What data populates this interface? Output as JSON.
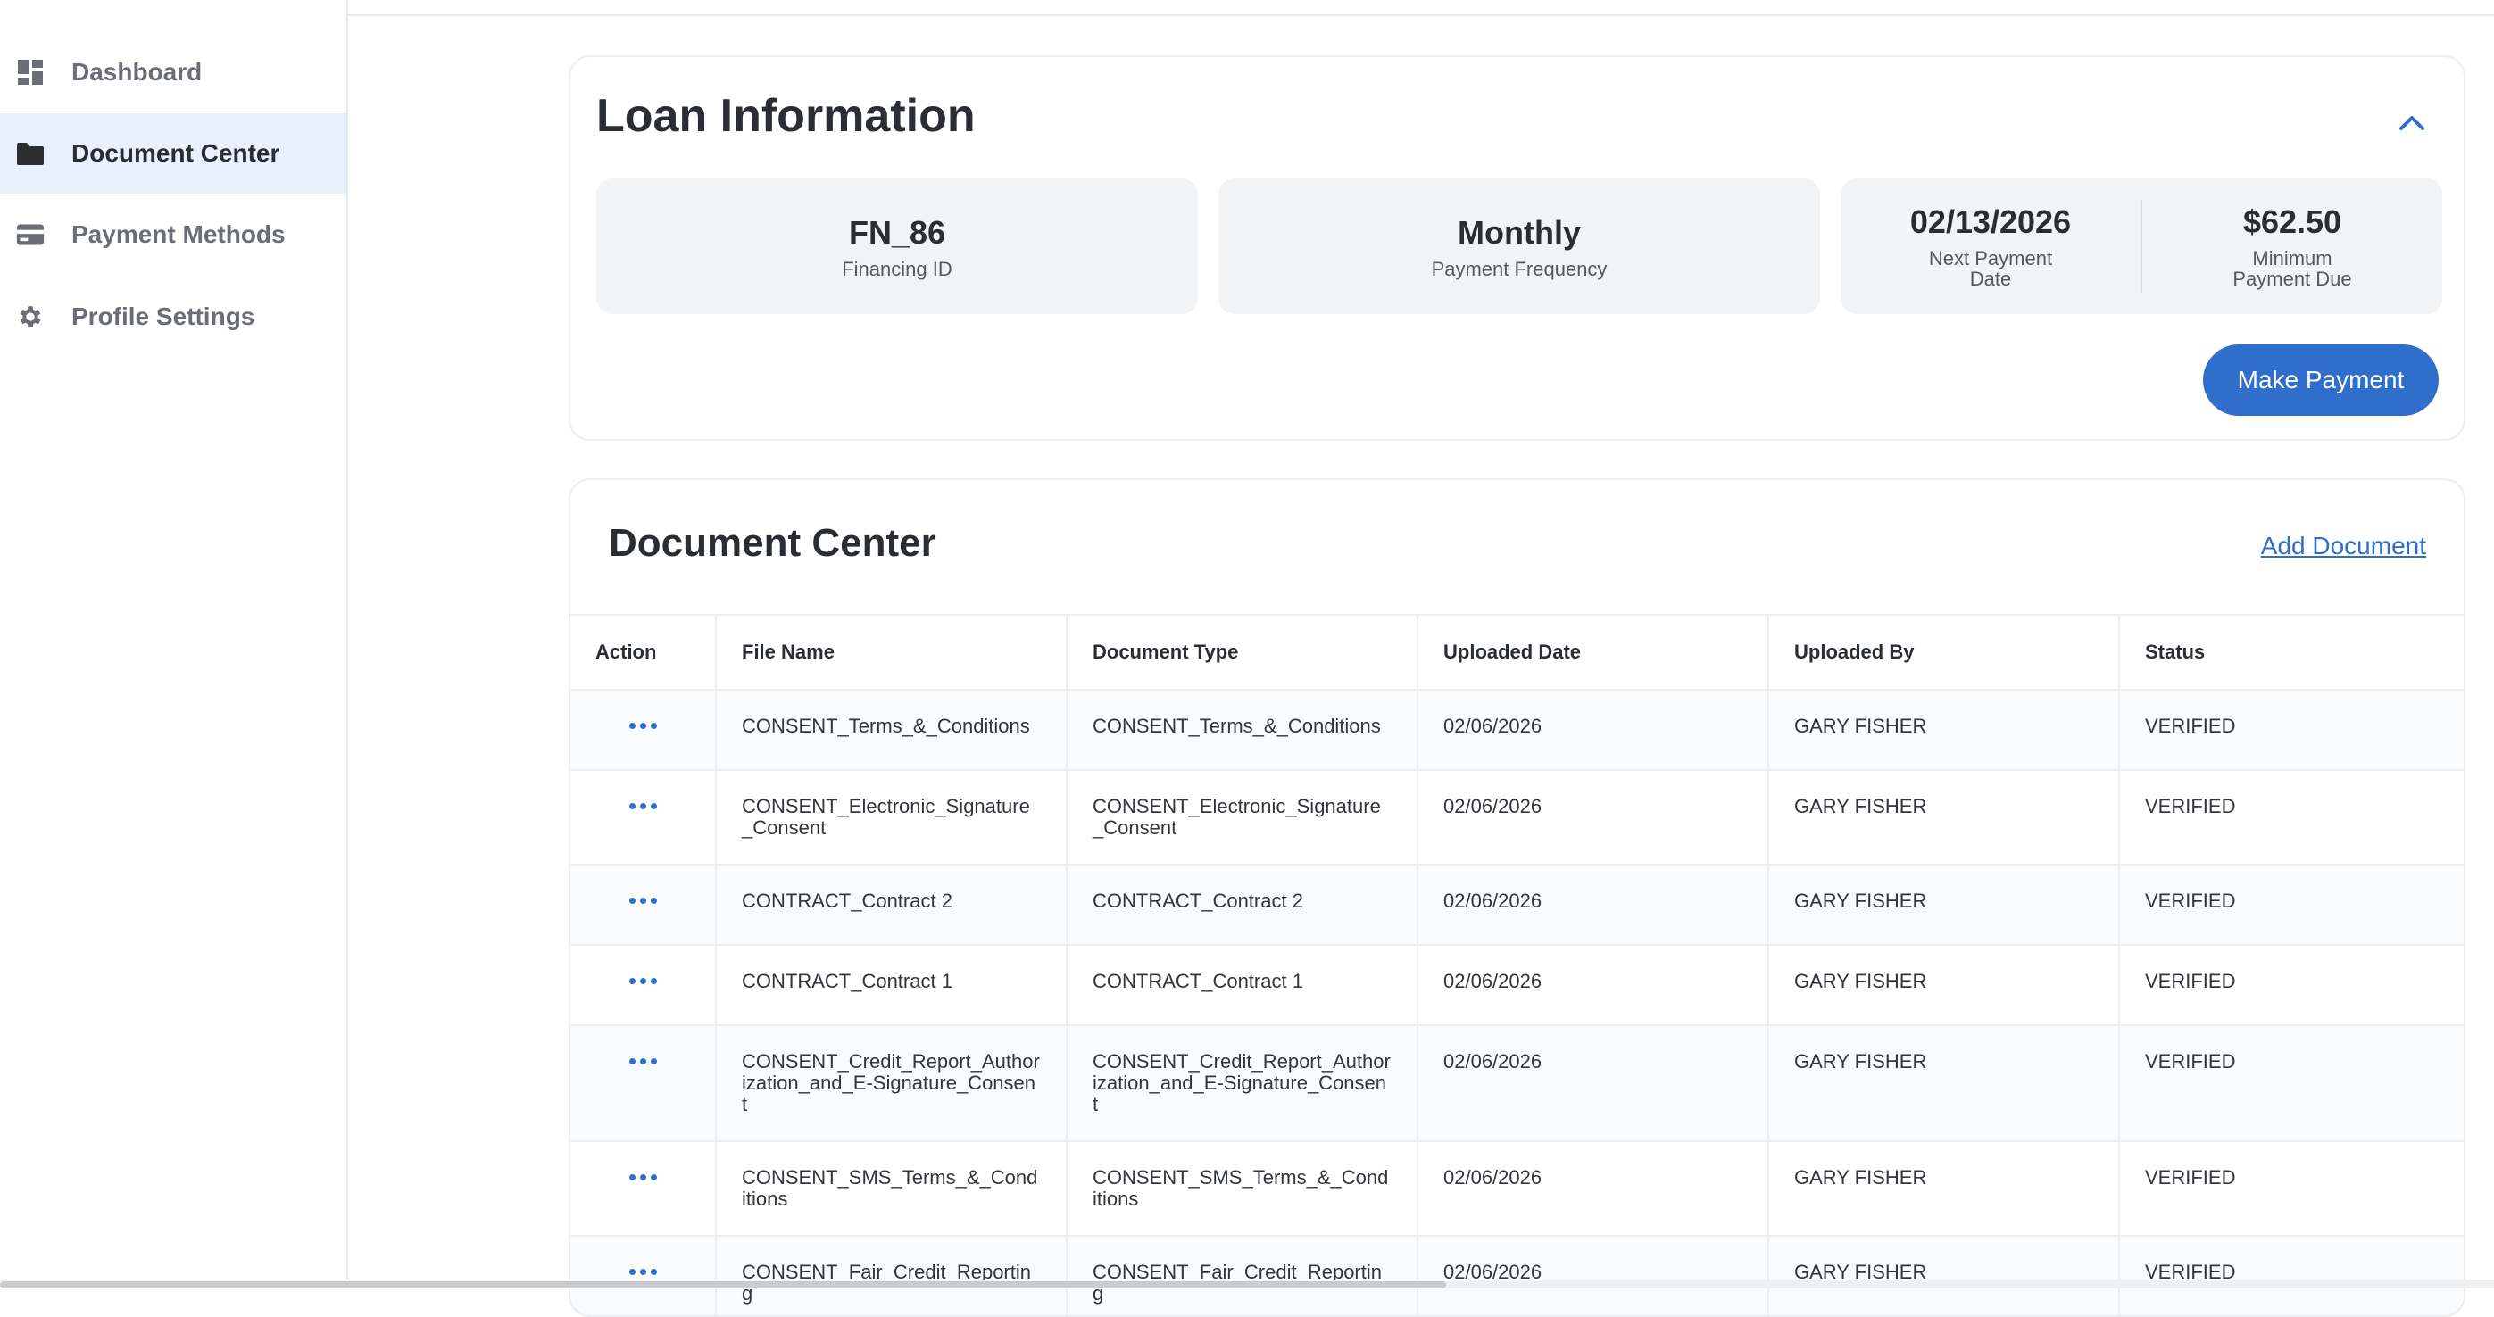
{
  "sidebar": {
    "items": [
      {
        "label": "Dashboard",
        "icon": "dashboard-icon",
        "active": false
      },
      {
        "label": "Document Center",
        "icon": "folder-icon",
        "active": true
      },
      {
        "label": "Payment Methods",
        "icon": "credit-card-icon",
        "active": false
      },
      {
        "label": "Profile Settings",
        "icon": "gear-icon",
        "active": false
      }
    ]
  },
  "loan": {
    "title": "Loan Information",
    "financing_id": {
      "value": "FN_86",
      "label": "Financing ID"
    },
    "frequency": {
      "value": "Monthly",
      "label": "Payment Frequency"
    },
    "next_payment": {
      "value": "02/13/2026",
      "label": "Next Payment Date"
    },
    "min_payment": {
      "value": "$62.50",
      "label": "Minimum Payment Due"
    },
    "pay_button": "Make Payment"
  },
  "documents": {
    "title": "Document Center",
    "add_link": "Add Document",
    "columns": [
      "Action",
      "File Name",
      "Document Type",
      "Uploaded Date",
      "Uploaded By",
      "Status"
    ],
    "rows": [
      {
        "file": "CONSENT_Terms_&_Conditions",
        "type": "CONSENT_Terms_&_Conditions",
        "date": "02/06/2026",
        "by": "GARY FISHER",
        "status": "VERIFIED"
      },
      {
        "file": "CONSENT_Electronic_Signature_Consent",
        "type": "CONSENT_Electronic_Signature_Consent",
        "date": "02/06/2026",
        "by": "GARY FISHER",
        "status": "VERIFIED"
      },
      {
        "file": "CONTRACT_Contract 2",
        "type": "CONTRACT_Contract 2",
        "date": "02/06/2026",
        "by": "GARY FISHER",
        "status": "VERIFIED"
      },
      {
        "file": "CONTRACT_Contract 1",
        "type": "CONTRACT_Contract 1",
        "date": "02/06/2026",
        "by": "GARY FISHER",
        "status": "VERIFIED"
      },
      {
        "file": "CONSENT_Credit_Report_Authorization_and_E-Signature_Consent",
        "type": "CONSENT_Credit_Report_Authorization_and_E-Signature_Consent",
        "date": "02/06/2026",
        "by": "GARY FISHER",
        "status": "VERIFIED"
      },
      {
        "file": "CONSENT_SMS_Terms_&_Conditions",
        "type": "CONSENT_SMS_Terms_&_Conditions",
        "date": "02/06/2026",
        "by": "GARY FISHER",
        "status": "VERIFIED"
      },
      {
        "file": "CONSENT_Fair_Credit_Reporting",
        "type": "CONSENT_Fair_Credit_Reporting",
        "date": "02/06/2026",
        "by": "GARY FISHER",
        "status": "VERIFIED"
      }
    ]
  },
  "colors": {
    "accent": "#2f6ecb",
    "active_nav_bg": "#e8f0fb"
  }
}
